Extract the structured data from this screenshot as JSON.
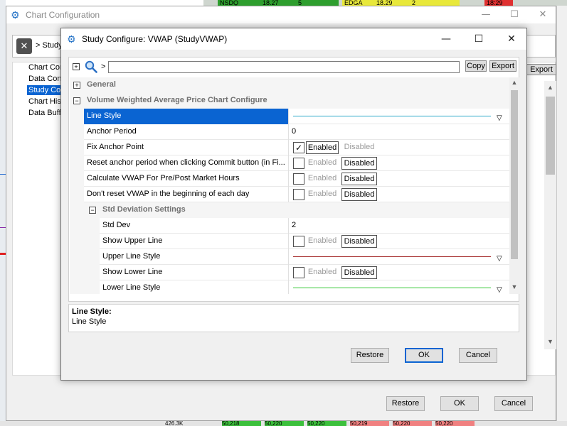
{
  "background": {
    "top_strip": [
      {
        "text": "NSDQ",
        "bg": "#2e9e2e"
      },
      {
        "text": "18.27",
        "bg": "#2e9e2e"
      },
      {
        "text": "5",
        "bg": "#2e9e2e"
      },
      {
        "text": "EDGA",
        "bg": "#e8e83a"
      },
      {
        "text": "18.29",
        "bg": "#e8e83a"
      },
      {
        "text": "2",
        "bg": "#e8e83a"
      },
      {
        "text": "18:29",
        "bg": "#e03030"
      }
    ],
    "bottom_strip": [
      {
        "text": "426.3K",
        "bg": "#e4e4e4"
      },
      {
        "text": "50,218",
        "bg": "#3cc03c"
      },
      {
        "text": "50,220",
        "bg": "#3cc03c"
      },
      {
        "text": "50,220",
        "bg": "#3cc03c"
      },
      {
        "text": "50,219",
        "bg": "#f08080"
      },
      {
        "text": "50,220",
        "bg": "#f08080"
      },
      {
        "text": "50,220",
        "bg": "#f08080"
      }
    ],
    "export_label": "Export"
  },
  "outer_window": {
    "title": "Chart Configuration",
    "path": "> Study",
    "tree": [
      "Chart Con",
      "Data Conf",
      "Study Cor",
      "Chart Hist",
      "Data Buffe"
    ],
    "selected_tree_index": 2,
    "buttons": {
      "restore": "Restore",
      "ok": "OK",
      "cancel": "Cancel"
    },
    "controls": {
      "minimize": "—",
      "maximize": "☐",
      "close": "✕"
    }
  },
  "dialog": {
    "title": "Study Configure: VWAP (StudyVWAP)",
    "controls": {
      "minimize": "—",
      "maximize": "☐",
      "close": "✕"
    },
    "toolbar": {
      "expand": "+",
      "crumb": ">",
      "search_value": "",
      "copy_label": "Copy",
      "export_label": "Export"
    },
    "categories": {
      "general": {
        "label": "General",
        "toggle": "+"
      },
      "vwap": {
        "label": "Volume Weighted Average Price Chart Configure",
        "toggle": "−"
      },
      "std": {
        "label": "Std Deviation Settings",
        "toggle": "−"
      }
    },
    "toggle_labels": {
      "enabled": "Enabled",
      "disabled": "Disabled",
      "check": "✓"
    },
    "rows": {
      "line_style": {
        "label": "Line Style",
        "line_color": "#2aa8c8"
      },
      "anchor_period": {
        "label": "Anchor Period",
        "value": "0"
      },
      "fix_anchor": {
        "label": "Fix Anchor Point",
        "state": "Enabled"
      },
      "reset_anchor": {
        "label": "Reset anchor period  when clicking Commit button (in Fi...",
        "state": "Disabled"
      },
      "calc_prepost": {
        "label": "Calculate VWAP For Pre/Post Market Hours",
        "state": "Disabled"
      },
      "dont_reset": {
        "label": "Don't reset VWAP in the beginning of each day",
        "state": "Disabled"
      },
      "std_dev": {
        "label": "Std Dev",
        "value": "2"
      },
      "show_upper": {
        "label": "Show Upper Line",
        "state": "Disabled"
      },
      "upper_style": {
        "label": "Upper Line Style",
        "line_color": "#a83232"
      },
      "show_lower": {
        "label": "Show Lower Line",
        "state": "Disabled"
      },
      "lower_style": {
        "label": "Lower Line Style",
        "line_color": "#32c832"
      }
    },
    "dropdown_arrow": "▽",
    "description": {
      "heading": "Line Style:",
      "body": "Line Style"
    },
    "buttons": {
      "restore": "Restore",
      "ok": "OK",
      "cancel": "Cancel"
    }
  }
}
